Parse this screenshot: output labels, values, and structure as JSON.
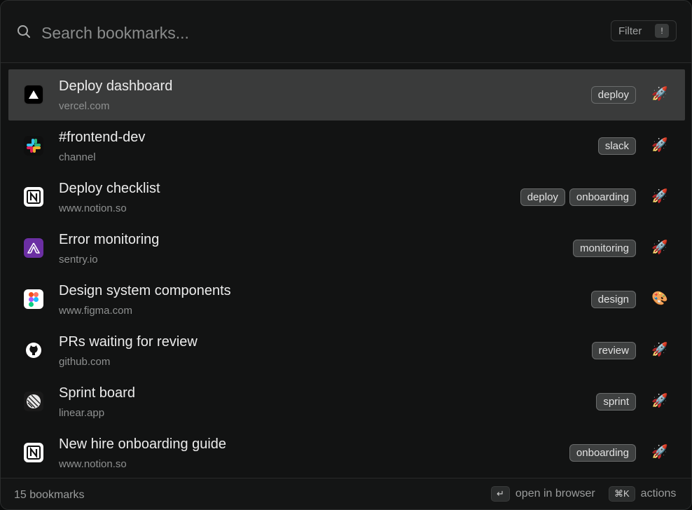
{
  "search": {
    "placeholder": "Search bookmarks...",
    "value": ""
  },
  "filter": {
    "label": "Filter",
    "shortcut": "!"
  },
  "bookmarks": [
    {
      "title": "Deploy dashboard",
      "subtitle": "vercel.com",
      "icon": "vercel-icon",
      "tags": [
        "deploy"
      ],
      "emoji": "🚀",
      "selected": true
    },
    {
      "title": "#frontend-dev",
      "subtitle": "channel",
      "icon": "slack-icon",
      "tags": [
        "slack"
      ],
      "emoji": "🚀"
    },
    {
      "title": "Deploy checklist",
      "subtitle": "www.notion.so",
      "icon": "notion-icon",
      "tags": [
        "deploy",
        "onboarding"
      ],
      "emoji": "🚀"
    },
    {
      "title": "Error monitoring",
      "subtitle": "sentry.io",
      "icon": "sentry-icon",
      "tags": [
        "monitoring"
      ],
      "emoji": "🚀"
    },
    {
      "title": "Design system components",
      "subtitle": "www.figma.com",
      "icon": "figma-icon",
      "tags": [
        "design"
      ],
      "emoji": "🎨"
    },
    {
      "title": "PRs waiting for review",
      "subtitle": "github.com",
      "icon": "github-icon",
      "tags": [
        "review"
      ],
      "emoji": "🚀"
    },
    {
      "title": "Sprint board",
      "subtitle": "linear.app",
      "icon": "linear-icon",
      "tags": [
        "sprint"
      ],
      "emoji": "🚀"
    },
    {
      "title": "New hire onboarding guide",
      "subtitle": "www.notion.so",
      "icon": "notion-icon",
      "tags": [
        "onboarding"
      ],
      "emoji": "🚀"
    }
  ],
  "footer": {
    "count": "15 bookmarks",
    "open_key": "↵",
    "open_label": "open in browser",
    "actions_key": "⌘K",
    "actions_label": "actions"
  },
  "colors": {
    "selected_row": "#3a3b3b",
    "background": "#121313",
    "sentry": "#6b2fa3"
  }
}
